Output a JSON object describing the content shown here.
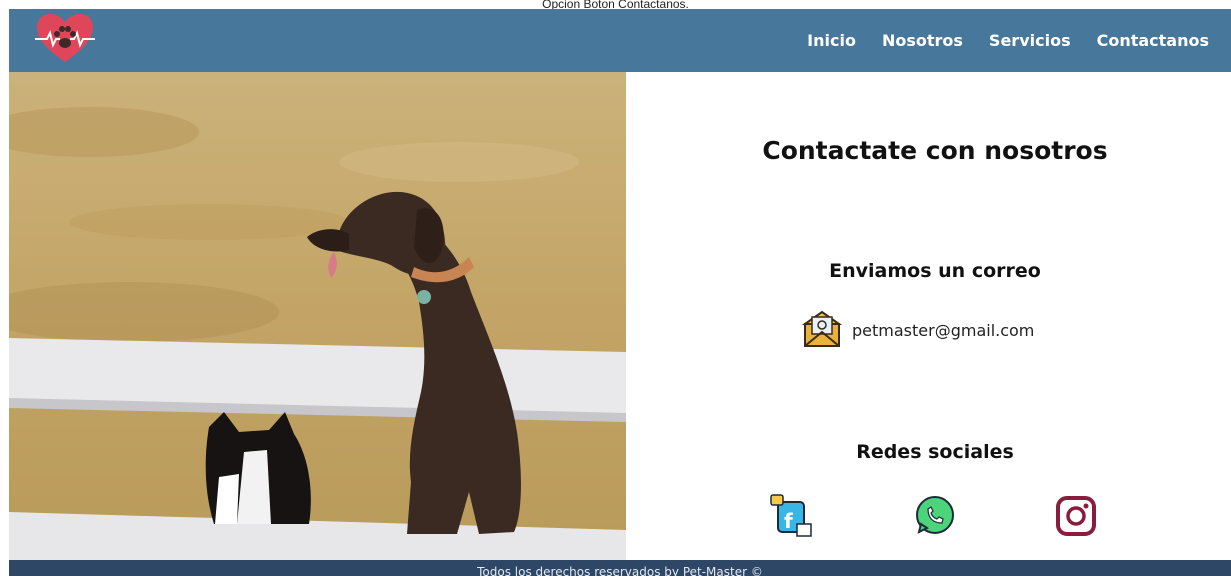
{
  "page_caption": "Opcion Boton Contactanos.",
  "nav": {
    "items": [
      {
        "label": "Inicio"
      },
      {
        "label": "Nosotros"
      },
      {
        "label": "Servicios"
      },
      {
        "label": "Contactanos"
      }
    ],
    "logo_icon": "heart-paw-icon"
  },
  "contact": {
    "title": "Contactate con nosotros",
    "email_title": "Enviamos un correo",
    "email_icon": "envelope-icon",
    "email": "petmaster@gmail.com",
    "social_title": "Redes sociales",
    "social_icons": [
      "facebook-icon",
      "whatsapp-icon",
      "instagram-icon"
    ]
  },
  "footer": {
    "text": "Todos los derechos reservados by Pet-Master ©"
  },
  "colors": {
    "nav_bg": "#47789c",
    "footer_bg": "#2e4766",
    "logo_heart": "#e0465a"
  }
}
